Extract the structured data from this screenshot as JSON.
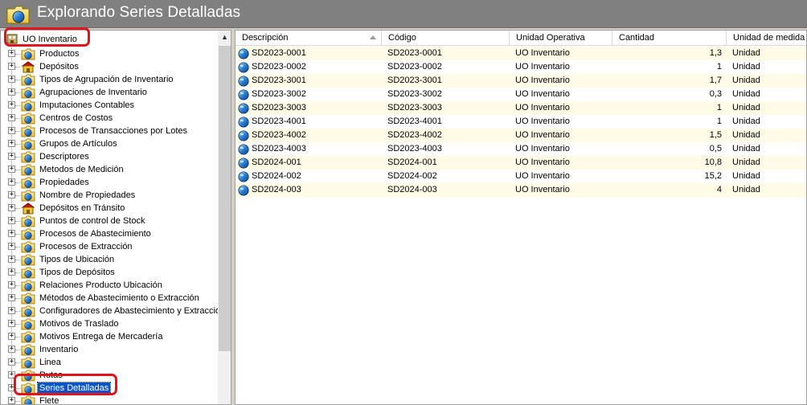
{
  "window": {
    "title": "Explorando Series Detalladas"
  },
  "tree": {
    "root_label": "UO Inventario",
    "items": [
      {
        "label": "Productos",
        "icon": "folder-icon"
      },
      {
        "label": "Depósitos",
        "icon": "warehouse-icon"
      },
      {
        "label": "Tipos de Agrupación de Inventario",
        "icon": "folder-globe-icon"
      },
      {
        "label": "Agrupaciones de Inventario",
        "icon": "folder-globe-icon"
      },
      {
        "label": "Imputaciones Contables",
        "icon": "folder-globe-icon"
      },
      {
        "label": "Centros de Costos",
        "icon": "folder-globe-icon"
      },
      {
        "label": "Procesos de Transacciones por Lotes",
        "icon": "folder-globe-icon"
      },
      {
        "label": "Grupos de Artículos",
        "icon": "folder-globe-icon"
      },
      {
        "label": "Descriptores",
        "icon": "folder-globe-icon"
      },
      {
        "label": "Metodos de Medición",
        "icon": "folder-globe-icon"
      },
      {
        "label": "Propiedades",
        "icon": "folder-globe-icon"
      },
      {
        "label": "Nombre de Propiedades",
        "icon": "folder-globe-icon"
      },
      {
        "label": "Depósitos en Tránsito",
        "icon": "warehouse-icon"
      },
      {
        "label": "Puntos de control de Stock",
        "icon": "folder-globe-icon"
      },
      {
        "label": "Procesos de Abastecimiento",
        "icon": "folder-globe-icon"
      },
      {
        "label": "Procesos de Extracción",
        "icon": "folder-globe-icon"
      },
      {
        "label": "Tipos de Ubicación",
        "icon": "folder-globe-icon"
      },
      {
        "label": "Tipos de Depósitos",
        "icon": "folder-globe-icon"
      },
      {
        "label": "Relaciones Producto Ubicación",
        "icon": "folder-globe-icon"
      },
      {
        "label": "Métodos de Abastecimiento o Extracción",
        "icon": "folder-globe-icon"
      },
      {
        "label": "Configuradores de Abastecimiento y Extracción",
        "icon": "folder-globe-icon"
      },
      {
        "label": "Motivos de Traslado",
        "icon": "folder-globe-icon"
      },
      {
        "label": "Motivos Entrega de Mercadería",
        "icon": "folder-globe-icon"
      },
      {
        "label": "Inventario",
        "icon": "folder-globe-icon"
      },
      {
        "label": "Linea",
        "icon": "folder-globe-icon"
      },
      {
        "label": "Rutas",
        "icon": "folder-globe-icon"
      },
      {
        "label": "Series Detalladas",
        "icon": "folder-globe-icon",
        "selected": true
      },
      {
        "label": "Flete",
        "icon": "folder-globe-icon"
      }
    ]
  },
  "grid": {
    "columns": [
      "Descripción",
      "Código",
      "Unidad Operativa",
      "Cantidad",
      "Unidad de medida"
    ],
    "rows": [
      [
        "SD2023-0001",
        "SD2023-0001",
        "UO Inventario",
        "1,3",
        "Unidad"
      ],
      [
        "SD2023-0002",
        "SD2023-0002",
        "UO Inventario",
        "1",
        "Unidad"
      ],
      [
        "SD2023-3001",
        "SD2023-3001",
        "UO Inventario",
        "1,7",
        "Unidad"
      ],
      [
        "SD2023-3002",
        "SD2023-3002",
        "UO Inventario",
        "0,3",
        "Unidad"
      ],
      [
        "SD2023-3003",
        "SD2023-3003",
        "UO Inventario",
        "1",
        "Unidad"
      ],
      [
        "SD2023-4001",
        "SD2023-4001",
        "UO Inventario",
        "1",
        "Unidad"
      ],
      [
        "SD2023-4002",
        "SD2023-4002",
        "UO Inventario",
        "1,5",
        "Unidad"
      ],
      [
        "SD2023-4003",
        "SD2023-4003",
        "UO Inventario",
        "0,5",
        "Unidad"
      ],
      [
        "SD2024-001",
        "SD2024-001",
        "UO Inventario",
        "10,8",
        "Unidad"
      ],
      [
        "SD2024-002",
        "SD2024-002",
        "UO Inventario",
        "15,2",
        "Unidad"
      ],
      [
        "SD2024-003",
        "SD2024-003",
        "UO Inventario",
        "4",
        "Unidad"
      ]
    ]
  },
  "colors": {
    "selection": "#0a54c8",
    "highlight": "#e0141e",
    "row_alt": "#fffbe6"
  }
}
